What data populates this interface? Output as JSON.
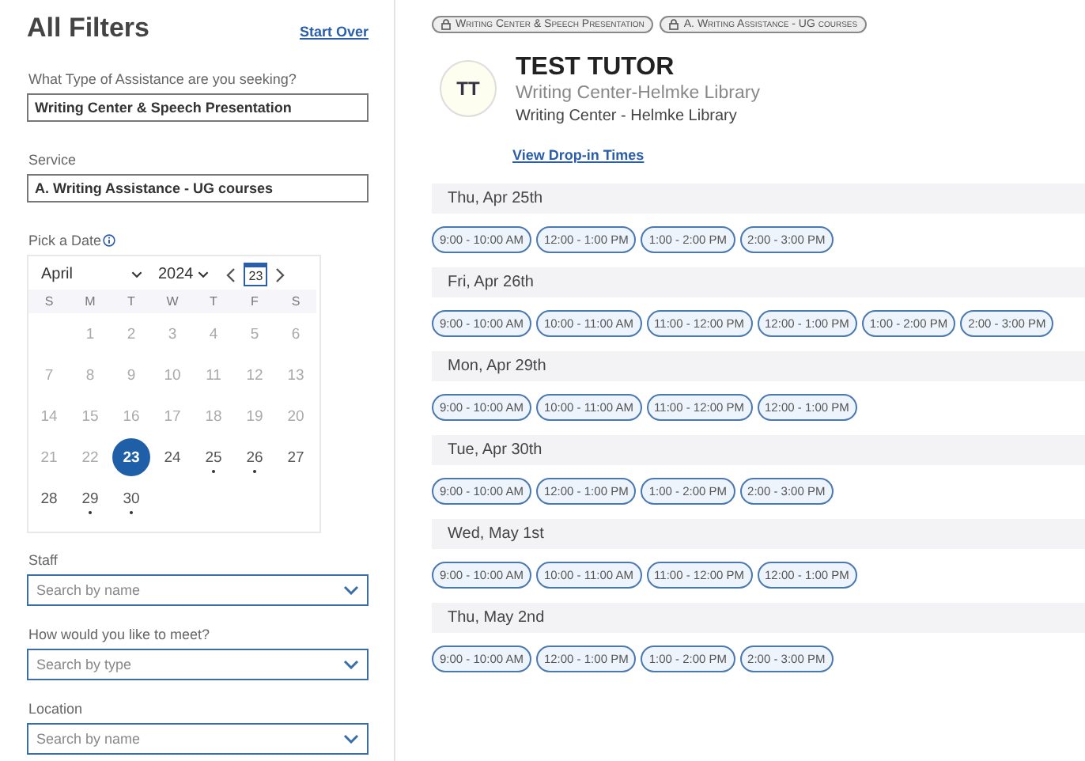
{
  "filters": {
    "title": "All Filters",
    "start_over": "Start Over",
    "assistance": {
      "label": "What Type of Assistance are you seeking?",
      "value": "Writing Center & Speech Presentation"
    },
    "service": {
      "label": "Service",
      "value": "A. Writing Assistance - UG courses"
    },
    "date_label": "Pick a Date",
    "calendar": {
      "month": "April",
      "year": "2024",
      "today": "23",
      "weekdays": [
        "S",
        "M",
        "T",
        "W",
        "T",
        "F",
        "S"
      ],
      "weeks": [
        [
          {
            "day": "1",
            "disabled": true,
            "available": false,
            "selected": false
          },
          {
            "day": "2",
            "disabled": true,
            "available": false,
            "selected": false
          },
          {
            "day": "3",
            "disabled": true,
            "available": false,
            "selected": false
          },
          {
            "day": "4",
            "disabled": true,
            "available": false,
            "selected": false
          },
          {
            "day": "5",
            "disabled": true,
            "available": false,
            "selected": false
          },
          {
            "day": "6",
            "disabled": true,
            "available": false,
            "selected": false
          }
        ],
        [
          {
            "day": "7",
            "disabled": true,
            "available": false,
            "selected": false
          },
          {
            "day": "8",
            "disabled": true,
            "available": false,
            "selected": false
          },
          {
            "day": "9",
            "disabled": true,
            "available": false,
            "selected": false
          },
          {
            "day": "10",
            "disabled": true,
            "available": false,
            "selected": false
          },
          {
            "day": "11",
            "disabled": true,
            "available": false,
            "selected": false
          },
          {
            "day": "12",
            "disabled": true,
            "available": false,
            "selected": false
          },
          {
            "day": "13",
            "disabled": true,
            "available": false,
            "selected": false
          }
        ],
        [
          {
            "day": "14",
            "disabled": true,
            "available": false,
            "selected": false
          },
          {
            "day": "15",
            "disabled": true,
            "available": false,
            "selected": false
          },
          {
            "day": "16",
            "disabled": true,
            "available": false,
            "selected": false
          },
          {
            "day": "17",
            "disabled": true,
            "available": false,
            "selected": false
          },
          {
            "day": "18",
            "disabled": true,
            "available": false,
            "selected": false
          },
          {
            "day": "19",
            "disabled": true,
            "available": false,
            "selected": false
          },
          {
            "day": "20",
            "disabled": true,
            "available": false,
            "selected": false
          }
        ],
        [
          {
            "day": "21",
            "disabled": true,
            "available": false,
            "selected": false
          },
          {
            "day": "22",
            "disabled": true,
            "available": false,
            "selected": false
          },
          {
            "day": "23",
            "disabled": false,
            "available": false,
            "selected": true
          },
          {
            "day": "24",
            "disabled": false,
            "available": false,
            "selected": false
          },
          {
            "day": "25",
            "disabled": false,
            "available": true,
            "selected": false
          },
          {
            "day": "26",
            "disabled": false,
            "available": true,
            "selected": false
          },
          {
            "day": "27",
            "disabled": false,
            "available": false,
            "selected": false
          }
        ],
        [
          {
            "day": "28",
            "disabled": false,
            "available": false,
            "selected": false
          },
          {
            "day": "29",
            "disabled": false,
            "available": true,
            "selected": false
          },
          {
            "day": "30",
            "disabled": false,
            "available": true,
            "selected": false
          }
        ]
      ]
    },
    "dropdowns": [
      {
        "label": "Staff",
        "placeholder": "Search by name"
      },
      {
        "label": "How would you like to meet?",
        "placeholder": "Search by type"
      },
      {
        "label": "Location",
        "placeholder": "Search by name"
      }
    ]
  },
  "chips": [
    "Writing Center & Speech Presentation",
    "A. Writing Assistance - UG courses"
  ],
  "tutor": {
    "initials": "TT",
    "name": "TEST TUTOR",
    "department": "Writing Center-Helmke Library",
    "location": "Writing Center - Helmke Library",
    "link": "View Drop-in Times"
  },
  "days": [
    {
      "date": "Thu, Apr 25th",
      "slots": [
        "9:00 - 10:00 AM",
        "12:00 - 1:00 PM",
        "1:00 - 2:00 PM",
        "2:00 - 3:00 PM"
      ]
    },
    {
      "date": "Fri, Apr 26th",
      "slots": [
        "9:00 - 10:00 AM",
        "10:00 - 11:00 AM",
        "11:00 - 12:00 PM",
        "12:00 - 1:00 PM",
        "1:00 - 2:00 PM",
        "2:00 - 3:00 PM"
      ]
    },
    {
      "date": "Mon, Apr 29th",
      "slots": [
        "9:00 - 10:00 AM",
        "10:00 - 11:00 AM",
        "11:00 - 12:00 PM",
        "12:00 - 1:00 PM"
      ]
    },
    {
      "date": "Tue, Apr 30th",
      "slots": [
        "9:00 - 10:00 AM",
        "12:00 - 1:00 PM",
        "1:00 - 2:00 PM",
        "2:00 - 3:00 PM"
      ]
    },
    {
      "date": "Wed, May 1st",
      "slots": [
        "9:00 - 10:00 AM",
        "10:00 - 11:00 AM",
        "11:00 - 12:00 PM",
        "12:00 - 1:00 PM"
      ]
    },
    {
      "date": "Thu, May 2nd",
      "slots": [
        "9:00 - 10:00 AM",
        "12:00 - 1:00 PM",
        "1:00 - 2:00 PM",
        "2:00 - 3:00 PM"
      ]
    }
  ]
}
